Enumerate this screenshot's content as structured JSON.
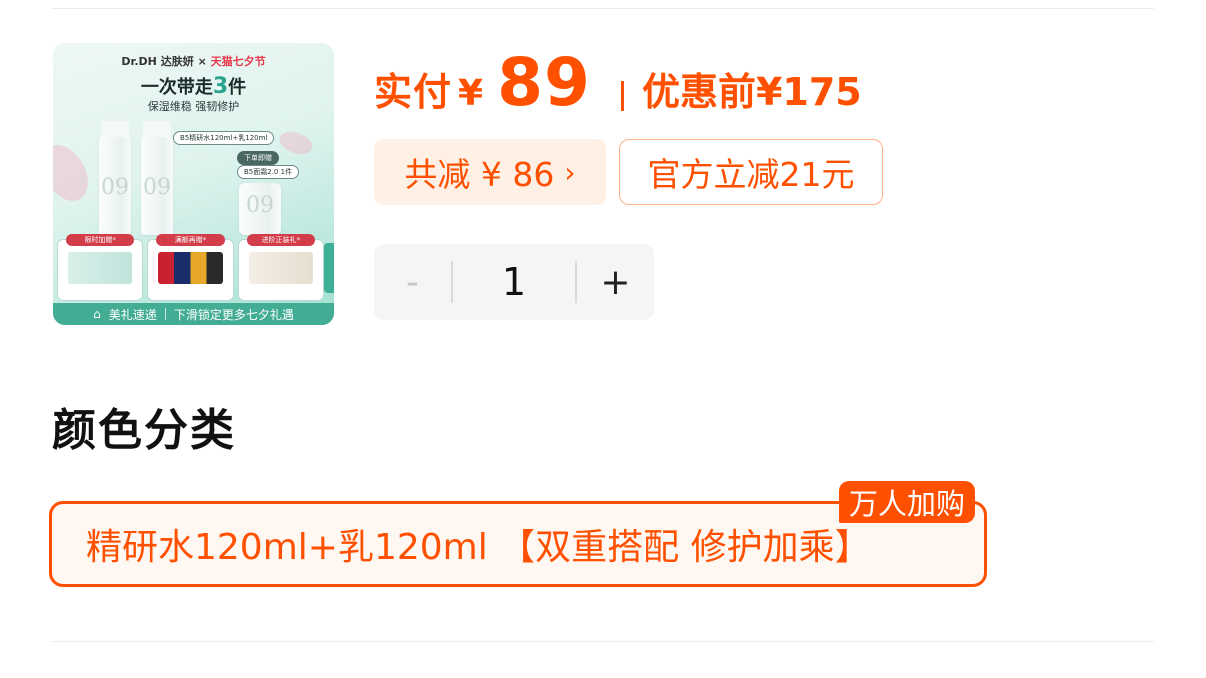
{
  "product_image": {
    "brand": "Dr.DH 达肤妍",
    "collab": "天猫七夕节",
    "headline_prefix": "一次带走",
    "headline_number": "3",
    "headline_suffix": "件",
    "subline": "保湿维稳  强韧修护",
    "bottle_note": "B5精研水120ml+乳120ml",
    "order_gift_tag": "下单即赠",
    "order_gift_item": "B5面霜2.0 1件",
    "gifts": [
      "限时加赠*",
      "满额再赠*",
      "进阶正装礼*"
    ],
    "footer_left": "美礼速递",
    "footer_right": "下滑锁定更多七夕礼遇",
    "side_tab": "下滑锁定"
  },
  "price": {
    "label": "实付",
    "currency": "¥",
    "amount": "89",
    "before_label": "优惠前",
    "before_amount": "¥175"
  },
  "discount": {
    "total_label": "共减 ¥ 86",
    "chevron": "›",
    "official_label": "官方立减21元"
  },
  "quantity": {
    "minus": "-",
    "value": "1",
    "plus": "+"
  },
  "section": {
    "title": "颜色分类"
  },
  "option": {
    "label": "精研水120ml+乳120ml 【双重搭配 修护加乘】",
    "badge": "万人加购"
  },
  "colors": {
    "accent": "#ff5000",
    "accent_light": "#fff0e6",
    "stepper_bg": "#f4f5f7",
    "thumb_green": "#42ad94"
  }
}
